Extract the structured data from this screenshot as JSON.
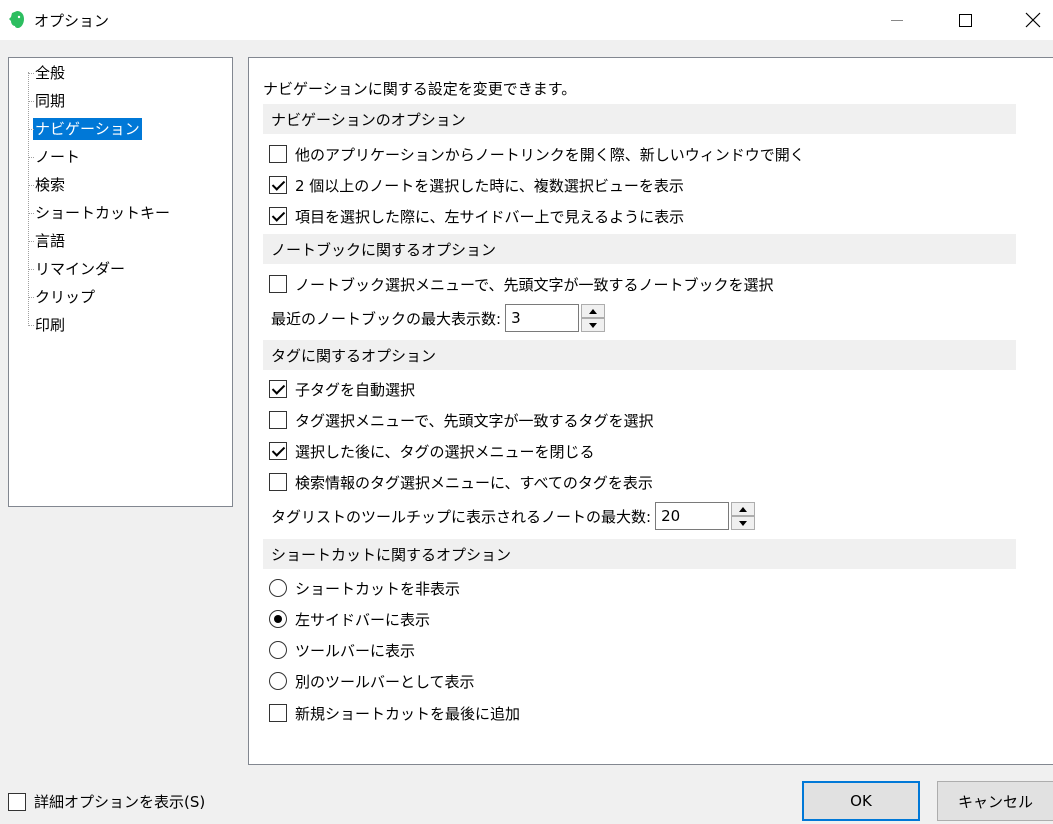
{
  "window": {
    "title": "オプション",
    "icon": "evernote-elephant-icon",
    "accent_color": "#0078d7",
    "logo_color": "#2dbe60"
  },
  "sidebar": {
    "items": [
      {
        "label": "全般",
        "selected": false
      },
      {
        "label": "同期",
        "selected": false
      },
      {
        "label": "ナビゲーション",
        "selected": true
      },
      {
        "label": "ノート",
        "selected": false
      },
      {
        "label": "検索",
        "selected": false
      },
      {
        "label": "ショートカットキー",
        "selected": false
      },
      {
        "label": "言語",
        "selected": false
      },
      {
        "label": "リマインダー",
        "selected": false
      },
      {
        "label": "クリップ",
        "selected": false
      },
      {
        "label": "印刷",
        "selected": false
      }
    ]
  },
  "main": {
    "description": "ナビゲーションに関する設定を変更できます。",
    "nav_section": {
      "title": "ナビゲーションのオプション",
      "options": [
        {
          "label": "他のアプリケーションからノートリンクを開く際、新しいウィンドウで開く",
          "checked": false
        },
        {
          "label": "2 個以上のノートを選択した時に、複数選択ビューを表示",
          "checked": true
        },
        {
          "label": "項目を選択した際に、左サイドバー上で見えるように表示",
          "checked": true
        }
      ]
    },
    "notebook_section": {
      "title": "ノートブックに関するオプション",
      "options": [
        {
          "label": "ノートブック選択メニューで、先頭文字が一致するノートブックを選択",
          "checked": false
        }
      ],
      "recent_label": "最近のノートブックの最大表示数:",
      "recent_value": "3"
    },
    "tag_section": {
      "title": "タグに関するオプション",
      "options": [
        {
          "label": "子タグを自動選択",
          "checked": true
        },
        {
          "label": "タグ選択メニューで、先頭文字が一致するタグを選択",
          "checked": false
        },
        {
          "label": "選択した後に、タグの選択メニューを閉じる",
          "checked": true
        },
        {
          "label": "検索情報のタグ選択メニューに、すべてのタグを表示",
          "checked": false
        }
      ],
      "tooltip_label": "タグリストのツールチップに表示されるノートの最大数:",
      "tooltip_value": "20"
    },
    "shortcut_section": {
      "title": "ショートカットに関するオプション",
      "radios": [
        {
          "label": "ショートカットを非表示",
          "checked": false
        },
        {
          "label": "左サイドバーに表示",
          "checked": true
        },
        {
          "label": "ツールバーに表示",
          "checked": false
        },
        {
          "label": "別のツールバーとして表示",
          "checked": false
        }
      ],
      "append": {
        "label": "新規ショートカットを最後に追加",
        "checked": false
      }
    }
  },
  "footer": {
    "advanced_label": "詳細オプションを表示(S)",
    "advanced_checked": false,
    "ok_label": "OK",
    "cancel_label": "キャンセル"
  }
}
